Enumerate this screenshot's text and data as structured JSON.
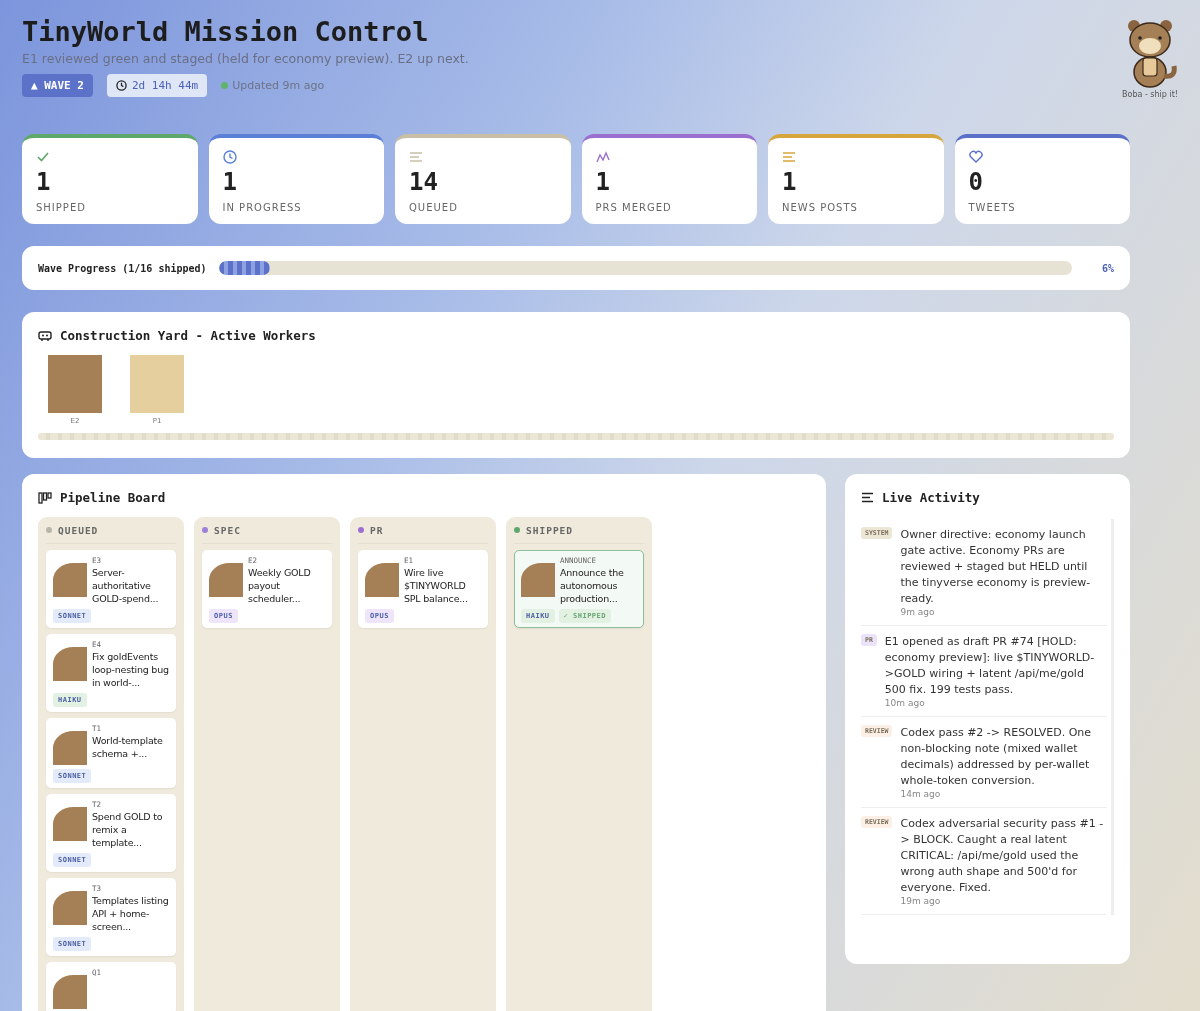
{
  "header": {
    "title": "TinyWorld Mission Control",
    "subtitle": "E1 reviewed green and staged (held for economy preview). E2 up next.",
    "wave_badge": "▲ WAVE 2",
    "timer": "2d 14h 44m",
    "status": "Updated 9m ago",
    "mascot_caption": "Boba - ship it!"
  },
  "stats": [
    {
      "kind": "check",
      "value": "1",
      "label": "SHIPPED",
      "color": "#5fa86b"
    },
    {
      "kind": "clock",
      "value": "1",
      "label": "IN PROGRESS",
      "color": "#5b7fd6"
    },
    {
      "kind": "lines",
      "value": "14",
      "label": "QUEUED",
      "color": "#c9bfa6"
    },
    {
      "kind": "chart",
      "value": "1",
      "label": "PRS MERGED",
      "color": "#9a6fd0"
    },
    {
      "kind": "lines",
      "value": "1",
      "label": "NEWS POSTS",
      "color": "#d6a63c"
    },
    {
      "kind": "heart",
      "value": "0",
      "label": "TWEETS",
      "color": "#5b70c8"
    }
  ],
  "progress": {
    "label": "Wave Progress (1/16 shipped)",
    "level": 0.06,
    "reading": "6%"
  },
  "workers": {
    "title": "Construction Yard - Active Workers",
    "items": [
      {
        "name": "E2",
        "color": "#a57f55"
      },
      {
        "name": "P1",
        "color": "#e6cf9f"
      }
    ]
  },
  "board": {
    "title": "Pipeline Board",
    "columns": [
      {
        "name": "QUEUED",
        "color": "#b8b4aa",
        "cards": [
          {
            "id": "E3",
            "title": "Server-authoritative GOLD-spend...",
            "model": "SONNET",
            "color": "#e3ebfa",
            "shipped": false
          },
          {
            "id": "E4",
            "title": "Fix goldEvents loop-nesting bug in world-...",
            "model": "HAIKU",
            "color": "#e2f1e2",
            "shipped": false
          },
          {
            "id": "T1",
            "title": "World-template schema +...",
            "model": "SONNET",
            "color": "#e3ebfa",
            "shipped": false
          },
          {
            "id": "T2",
            "title": "Spend GOLD to remix a template...",
            "model": "SONNET",
            "color": "#e3ebfa",
            "shipped": false
          },
          {
            "id": "T3",
            "title": "Templates listing API + home-screen...",
            "model": "SONNET",
            "color": "#e3ebfa",
            "shipped": false
          },
          {
            "id": "Q1"
          }
        ]
      },
      {
        "name": "SPEC",
        "color": "#9b82d8",
        "cards": [
          {
            "id": "E2",
            "title": "Weekly GOLD payout scheduler...",
            "model": "OPUS",
            "color": "#efe5fb",
            "shipped": false
          }
        ]
      },
      {
        "name": "PR",
        "color": "#9b6fd0",
        "cards": [
          {
            "id": "E1",
            "title": "Wire live $TINYWORLD SPL balance...",
            "model": "OPUS",
            "color": "#efe5fb",
            "shipped": false
          }
        ]
      },
      {
        "name": "SHIPPED",
        "color": "#5fa86b",
        "cards": [
          {
            "id": "ANNOUNCE",
            "title": "Announce the autonomous production...",
            "model": "HAIKU",
            "color": "#e2f1e2",
            "shipped": true,
            "shipped_label": "✓ SHIPPED"
          }
        ]
      }
    ]
  },
  "activity": {
    "title": "Live Activity",
    "items": [
      {
        "tag": "SYSTEM",
        "color": "#ece6d6",
        "text": "Owner directive: economy launch gate active. Economy PRs are reviewed + staged but HELD until the tinyverse economy is preview-ready.",
        "time": "9m ago"
      },
      {
        "tag": "PR",
        "color": "#ece3fb",
        "text": "E1 opened as draft PR #74 [HOLD: economy preview]: live $TINYWORLD->GOLD wiring + latent /api/me/gold 500 fix. 199 tests pass.",
        "time": "10m ago"
      },
      {
        "tag": "REVIEW",
        "color": "#fbefe6",
        "text": "Codex pass #2 -> RESOLVED. One non-blocking note (mixed wallet decimals) addressed by per-wallet whole-token conversion.",
        "time": "14m ago"
      },
      {
        "tag": "REVIEW",
        "color": "#fbefe6",
        "text": "Codex adversarial security pass #1 -> BLOCK. Caught a real latent CRITICAL: /api/me/gold used the wrong auth shape and 500'd for everyone. Fixed.",
        "time": "19m ago"
      }
    ]
  }
}
